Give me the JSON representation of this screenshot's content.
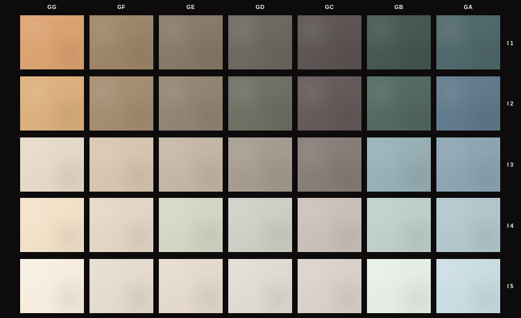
{
  "columns": [
    "GG",
    "GF",
    "GE",
    "GD",
    "GC",
    "GB",
    "GA"
  ],
  "rows": [
    {
      "label": "I 1",
      "colors": [
        "#dca26f",
        "#9d8466",
        "#857866",
        "#6b665d",
        "#5a5250",
        "#42554f",
        "#4d6669"
      ]
    },
    {
      "label": "I 2",
      "colors": [
        "#ddb07c",
        "#a58c6f",
        "#928371",
        "#6e6d62",
        "#625857",
        "#50675f",
        "#5f788a"
      ]
    },
    {
      "label": "I 3",
      "colors": [
        "#e7dbc8",
        "#d8c6b0",
        "#c5b7a5",
        "#a59b90",
        "#877b76",
        "#96b0b6",
        "#8ca4b3"
      ]
    },
    {
      "label": "I 4",
      "colors": [
        "#f5e3ca",
        "#e4d8c7",
        "#d7d7c7",
        "#d0d0c7",
        "#ccc1ba",
        "#bfd1c9",
        "#b2c9cd"
      ]
    },
    {
      "label": "I 5",
      "colors": [
        "#f9f0e1",
        "#e7ddd1",
        "#e7dccd",
        "#e2ddd4",
        "#ddd2cc",
        "#e7f0e6",
        "#cbdfe4"
      ]
    }
  ]
}
